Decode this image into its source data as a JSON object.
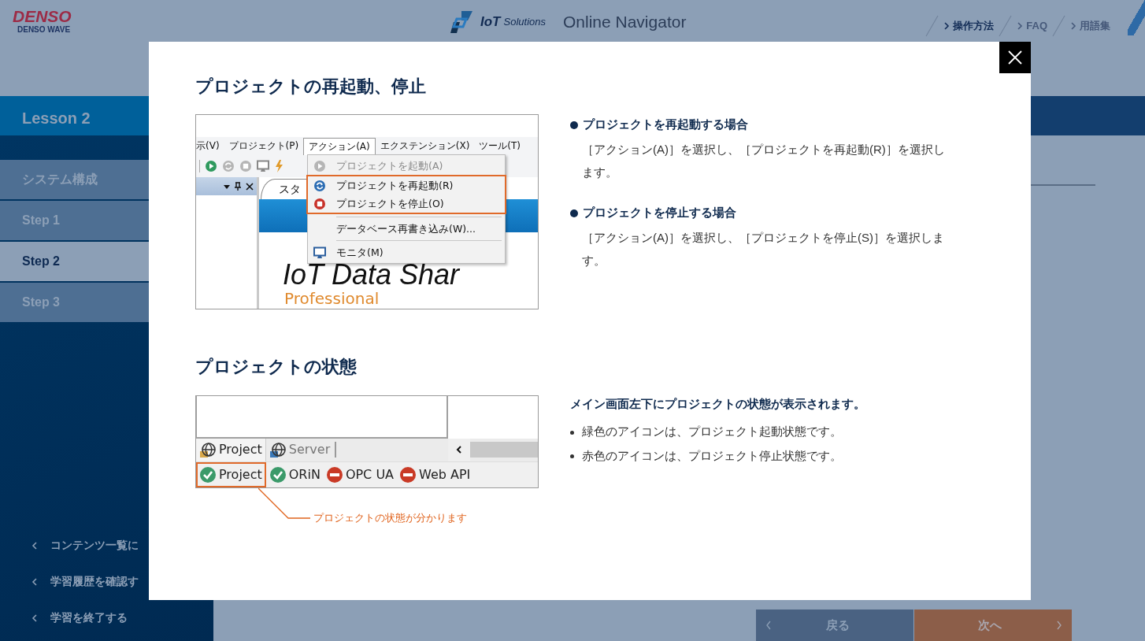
{
  "header": {
    "logo": {
      "brand": "DENSO",
      "subtitle": "DENSO WAVE"
    },
    "product": {
      "mark": "IoT",
      "suffix": "Solutions",
      "title": "Online Navigator"
    },
    "links": [
      {
        "label": "操作方法",
        "selected": true
      },
      {
        "label": "FAQ",
        "selected": false
      },
      {
        "label": "用語集",
        "selected": false
      }
    ]
  },
  "lesson": {
    "title": "Lesson 2"
  },
  "sidebar": {
    "items": [
      {
        "label": "システム構成",
        "selected": false
      },
      {
        "label": "Step 1",
        "selected": false
      },
      {
        "label": "Step 2",
        "selected": true
      },
      {
        "label": "Step 3",
        "selected": false
      }
    ],
    "links": [
      "コンテンツ一覧に",
      "学習履歴を確認す",
      "学習を終了する"
    ]
  },
  "footer_nav": {
    "back": "戻る",
    "next": "次へ"
  },
  "modal": {
    "sections": [
      {
        "title": "プロジェクトの再起動、停止",
        "screenshot": {
          "kind": "menu",
          "menubar": [
            {
              "label": "示(V)",
              "selected": false
            },
            {
              "label": "プロジェクト(P)",
              "selected": false
            },
            {
              "label": "アクション(A)",
              "selected": true
            },
            {
              "label": "エクステンション(X)",
              "selected": false
            },
            {
              "label": "ツール(T)",
              "selected": false
            }
          ],
          "tab": "スタ",
          "logo_text": "IoT Data Shar",
          "logo_sub": "Professional",
          "menu": [
            {
              "kind": "play",
              "label": "プロジェクトを起動(A)",
              "disabled": true,
              "highlighted": false
            },
            {
              "kind": "restart",
              "label": "プロジェクトを再起動(R)",
              "disabled": false,
              "highlighted": true
            },
            {
              "kind": "stop",
              "label": "プロジェクトを停止(O)",
              "disabled": false,
              "highlighted": true
            },
            {
              "kind": "separator"
            },
            {
              "kind": "plain",
              "label": "データベース再書き込み(W)...",
              "disabled": false,
              "highlighted": false
            },
            {
              "kind": "separator"
            },
            {
              "kind": "monitor",
              "label": "モニタ(M)",
              "disabled": false,
              "highlighted": false
            }
          ]
        },
        "notes": [
          {
            "heading": "プロジェクトを再起動する場合",
            "body": "［アクション(A)］を選択し、［プロジェクトを再起動(R)］を選択します。"
          },
          {
            "heading": "プロジェクトを停止する場合",
            "body": "［アクション(A)］を選択し、［プロジェクトを停止(S)］を選択します。"
          }
        ]
      },
      {
        "title": "プロジェクトの状態",
        "screenshot": {
          "kind": "status",
          "tabs": [
            {
              "label": "Project",
              "selected": true
            },
            {
              "label": "Server",
              "selected": false
            }
          ],
          "status": [
            {
              "label": "Project",
              "kind": "ok",
              "highlighted": true
            },
            {
              "label": "ORiN",
              "kind": "ok",
              "highlighted": false
            },
            {
              "label": "OPC UA",
              "kind": "error",
              "highlighted": false
            },
            {
              "label": "Web API",
              "kind": "error",
              "highlighted": false
            }
          ],
          "callout": "プロジェクトの状態が分かります"
        },
        "lead": "メイン画面左下にプロジェクトの状態が表示されます。",
        "bullets": [
          "緑色のアイコンは、プロジェクト起動状態です。",
          "赤色のアイコンは、プロジェクト停止状態です。"
        ]
      }
    ]
  }
}
